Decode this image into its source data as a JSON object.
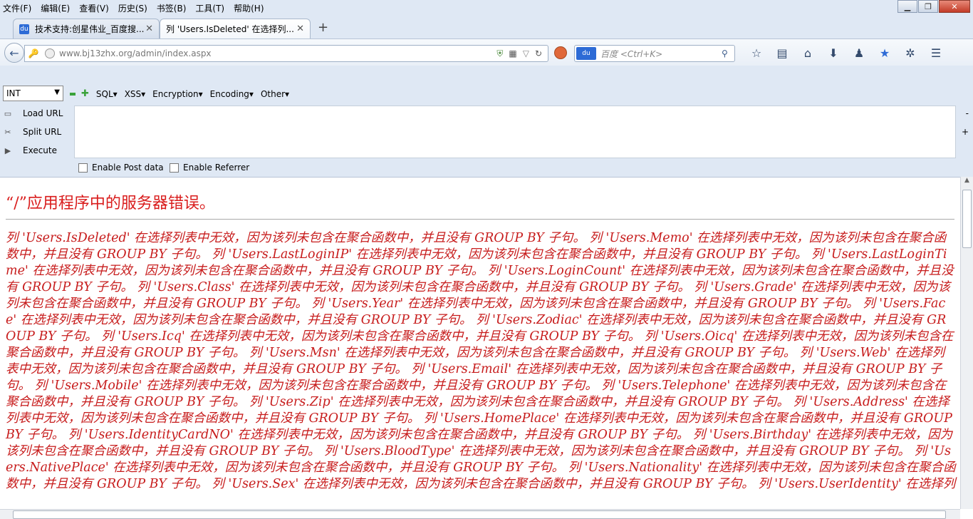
{
  "menu": [
    "文件(F)",
    "编辑(E)",
    "查看(V)",
    "历史(S)",
    "书签(B)",
    "工具(T)",
    "帮助(H)"
  ],
  "tabs": [
    {
      "label": "技术支持:创星伟业_百度搜..."
    },
    {
      "label": "列 'Users.IsDeleted' 在选择列..."
    }
  ],
  "address": {
    "url": "www.bj13zhx.org/admin/index.aspx"
  },
  "search": {
    "placeholder": "百度 <Ctrl+K>",
    "engine_label": "du"
  },
  "hackbar": {
    "select_value": "INT",
    "menu": [
      "SQL▾",
      "XSS▾",
      "Encryption▾",
      "Encoding▾",
      "Other▾"
    ],
    "load_url": "Load URL",
    "split_url": "Split URL",
    "execute": "Execute",
    "enable_post": "Enable Post data",
    "enable_referrer": "Enable Referrer"
  },
  "page": {
    "title": "“/”应用程序中的服务器错误。",
    "message": "列 'Users.IsDeleted' 在选择列表中无效，因为该列未包含在聚合函数中，并且没有 GROUP BY 子句。 列 'Users.Memo' 在选择列表中无效，因为该列未包含在聚合函数中，并且没有 GROUP BY 子句。 列 'Users.LastLoginIP' 在选择列表中无效，因为该列未包含在聚合函数中，并且没有 GROUP BY 子句。 列 'Users.LastLoginTime' 在选择列表中无效，因为该列未包含在聚合函数中，并且没有 GROUP BY 子句。 列 'Users.LoginCount' 在选择列表中无效，因为该列未包含在聚合函数中，并且没有 GROUP BY 子句。 列 'Users.Class' 在选择列表中无效，因为该列未包含在聚合函数中，并且没有 GROUP BY 子句。 列 'Users.Grade' 在选择列表中无效，因为该列未包含在聚合函数中，并且没有 GROUP BY 子句。 列 'Users.Year' 在选择列表中无效，因为该列未包含在聚合函数中，并且没有 GROUP BY 子句。 列 'Users.Face' 在选择列表中无效，因为该列未包含在聚合函数中，并且没有 GROUP BY 子句。 列 'Users.Zodiac' 在选择列表中无效，因为该列未包含在聚合函数中，并且没有 GROUP BY 子句。 列 'Users.Icq' 在选择列表中无效，因为该列未包含在聚合函数中，并且没有 GROUP BY 子句。 列 'Users.Oicq' 在选择列表中无效，因为该列未包含在聚合函数中，并且没有 GROUP BY 子句。 列 'Users.Msn' 在选择列表中无效，因为该列未包含在聚合函数中，并且没有 GROUP BY 子句。 列 'Users.Web' 在选择列表中无效，因为该列未包含在聚合函数中，并且没有 GROUP BY 子句。 列 'Users.Email' 在选择列表中无效，因为该列未包含在聚合函数中，并且没有 GROUP BY 子句。 列 'Users.Mobile' 在选择列表中无效，因为该列未包含在聚合函数中，并且没有 GROUP BY 子句。 列 'Users.Telephone' 在选择列表中无效，因为该列未包含在聚合函数中，并且没有 GROUP BY 子句。 列 'Users.Zip' 在选择列表中无效，因为该列未包含在聚合函数中，并且没有 GROUP BY 子句。 列 'Users.Address' 在选择列表中无效，因为该列未包含在聚合函数中，并且没有 GROUP BY 子句。 列 'Users.HomePlace' 在选择列表中无效，因为该列未包含在聚合函数中，并且没有 GROUP BY 子句。 列 'Users.IdentityCardNO' 在选择列表中无效，因为该列未包含在聚合函数中，并且没有 GROUP BY 子句。 列 'Users.Birthday' 在选择列表中无效，因为该列未包含在聚合函数中，并且没有 GROUP BY 子句。 列 'Users.BloodType' 在选择列表中无效，因为该列未包含在聚合函数中，并且没有 GROUP BY 子句。 列 'Users.NativePlace' 在选择列表中无效，因为该列未包含在聚合函数中，并且没有 GROUP BY 子句。 列 'Users.Nationality' 在选择列表中无效，因为该列未包含在聚合函数中，并且没有 GROUP BY 子句。 列 'Users.Sex' 在选择列表中无效，因为该列未包含在聚合函数中，并且没有 GROUP BY 子句。 列 'Users.UserIdentity' 在选择列"
  },
  "colors": {
    "error_red": "#d91c1c",
    "chrome_bg": "#dfe8f4"
  },
  "icons": [
    "back-icon",
    "key-icon",
    "globe-icon",
    "shield-icon",
    "qr-icon",
    "reload-icon",
    "stop-icon",
    "magnifier-icon",
    "star-icon",
    "clipboard-icon",
    "home-icon",
    "download-icon",
    "user-icon",
    "addon-icon",
    "menu-icon",
    "close-icon",
    "plus-icon"
  ]
}
